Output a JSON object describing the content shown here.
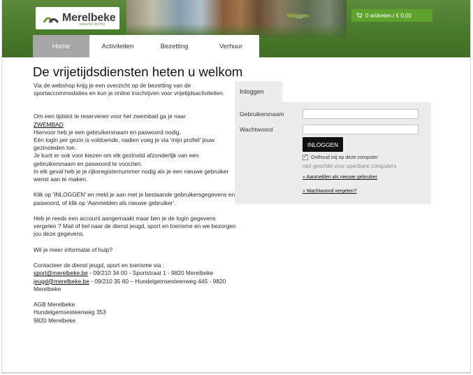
{
  "header": {
    "logo_text": "Merelbeke",
    "logo_tagline": "natuurlijk dichtbij",
    "login_link": "Inloggen",
    "cart_label": "0 artikelen / € 0,00",
    "brand_color": "#4a7a2c",
    "accent_color": "#5fa32e"
  },
  "nav": {
    "items": [
      {
        "label": "Home",
        "active": true
      },
      {
        "label": "Activiteiten",
        "active": false
      },
      {
        "label": "Bezetting",
        "active": false
      },
      {
        "label": "Verhuur",
        "active": false
      }
    ]
  },
  "main": {
    "title": "De vrijetijdsdiensten heten u welkom",
    "intro": "Via de webshop krijg je een overzicht op de bezetting van de sportaccommodaties en kun je online inschrijven voor vrijetijdsactiviteiten.",
    "zwembad_intro": "Om een tijdslot te reserveren voor het zwembad ga je naar",
    "zwembad_link": "ZWEMBAD",
    "zwembad_l1": "Hiervoor heb je een gebruikersnaam en paswoord nodig.",
    "zwembad_l2": "Eén login per gezin is voldoende, nadien voeg je via 'mijn profiel' jouw gezinsleden toe.",
    "zwembad_l3": "Je kunt er ook voor kiezen om elk gezinslid afzonderlijk van een gebruikersnaam en paswoord te voorzien.",
    "zwembad_l4": "In elk geval heb je je rijksregisternummer nodig als je een nieuwe gebruiker wenst aan te maken.",
    "klik": "Klik op 'INLOGGEN' en meld je aan met je bestaande gebruikersgegevens en paswoord, of klik op 'Aanmelden als nieuwe gebruiker'.",
    "account": "Heb je reeds een account aangemaakt maar ben je de login gegevens vergeten ? Mail of bel naar de dienst jeugd, sport en toerisme en we bezorgen jou deze gegevens.",
    "meer_info": "Wil je meer informatie of hulp?",
    "contact_intro": "Contacteer de dienst jeugd, sport en toerisme via :",
    "contact1_email": "sport@merelbeke.be",
    "contact1_rest": " - 09/210 34 00  - Sportstraat 1 - 9820 Merelbeke",
    "contact2_email": "jeugd@merelbeke.be",
    "contact2_rest": " - 09/210 35 60 –  Hundelgemsesteenweg 445 - 9820 Merelbeke",
    "agb_name": "AGB Merelbeke",
    "agb_street": "Hundelgemsesteenweg 353",
    "agb_city": "9820 Merelbeke"
  },
  "login": {
    "tab": "Inloggen",
    "username_label": "Gebruikersnaam",
    "password_label": "Wachtwoord",
    "username_value": "",
    "password_value": "",
    "button": "INLOGGEN",
    "remember": "Onthoud mij op deze computer",
    "remember_checked": true,
    "hint": "niet geschikt voor openbare computers",
    "register_link": "» Aanmelden als nieuwe gebruiker",
    "forgot_link": "» Wachtwoord vergeten?"
  }
}
